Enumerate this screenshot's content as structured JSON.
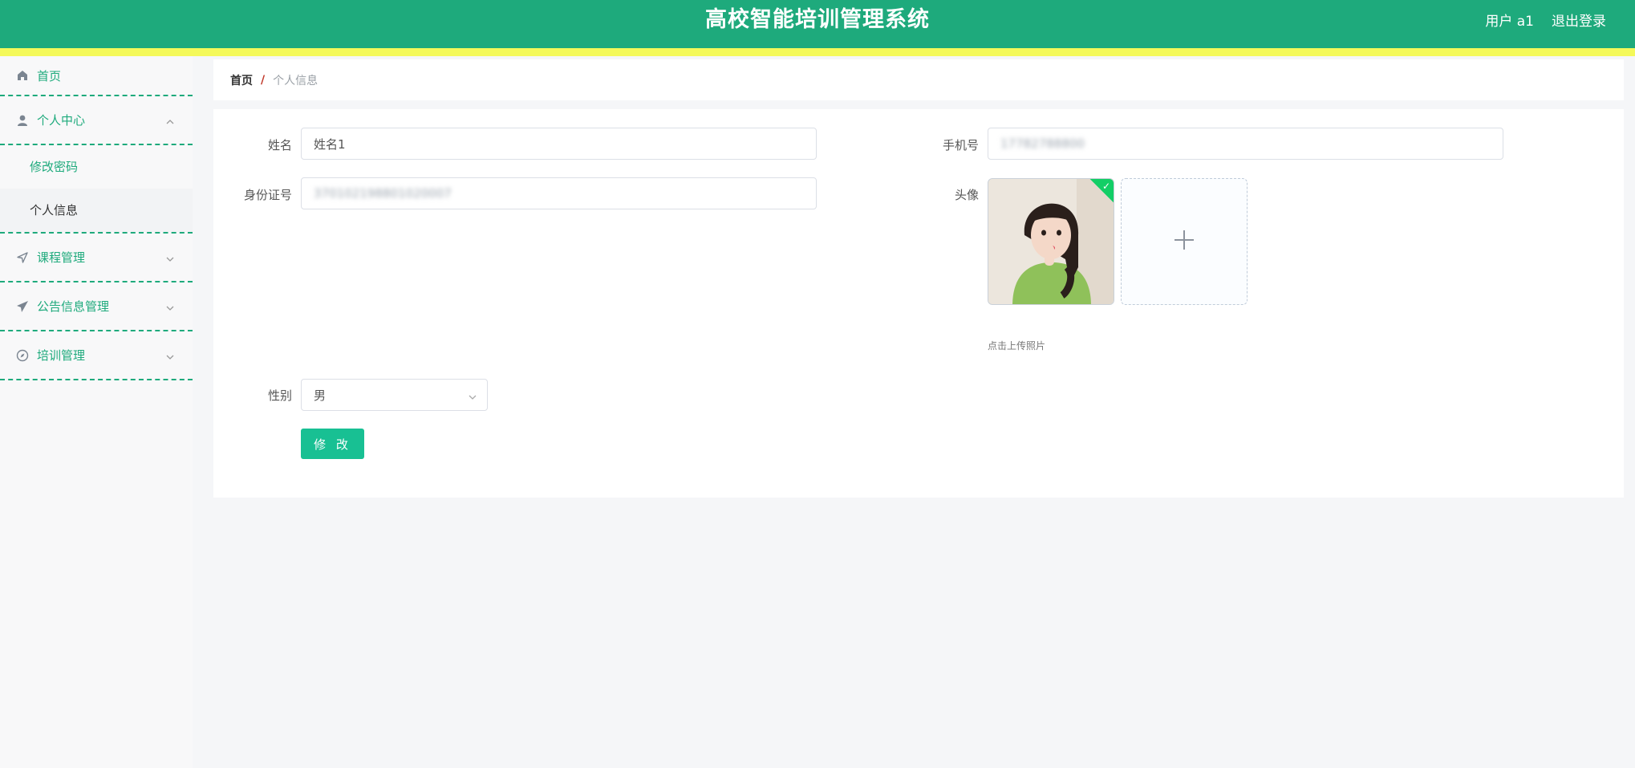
{
  "header": {
    "title": "高校智能培训管理系统",
    "user_label": "用户 a1",
    "logout_label": "退出登录"
  },
  "sidebar": {
    "home": "首页",
    "personal_center": "个人中心",
    "change_password": "修改密码",
    "personal_info": "个人信息",
    "course_management": "课程管理",
    "announcement_management": "公告信息管理",
    "training_management": "培训管理"
  },
  "breadcrumb": {
    "home": "首页",
    "separator": "/",
    "current": "个人信息"
  },
  "form": {
    "name_label": "姓名",
    "name_value": "姓名1",
    "phone_label": "手机号",
    "phone_value": "17782788800",
    "id_label": "身份证号",
    "id_value": "370102198801020007",
    "avatar_label": "头像",
    "upload_hint": "点击上传照片",
    "gender_label": "性别",
    "gender_value": "男",
    "submit_label": "修 改"
  },
  "colors": {
    "brand": "#1eaa7c",
    "stripe": "#f4f95a",
    "button": "#18c093",
    "success_badge": "#13ce66"
  },
  "icons": [
    "home-icon",
    "user-icon",
    "chevron-up-icon",
    "chevron-down-icon",
    "navigation-icon",
    "send-icon",
    "compass-icon",
    "plus-icon",
    "check-icon"
  ]
}
